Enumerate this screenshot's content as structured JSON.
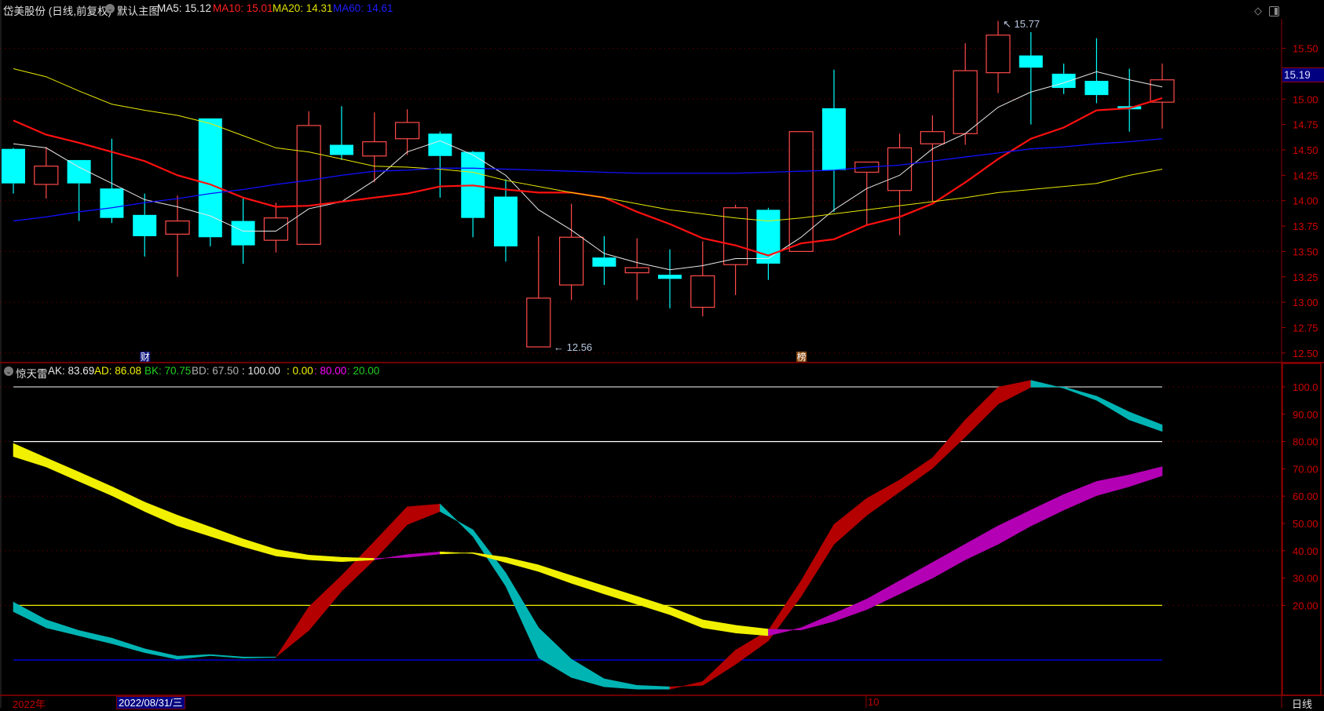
{
  "header": {
    "title": "岱美股份 (日线,前复权)",
    "template": "默认主图",
    "ma": [
      {
        "label": "MA5: 15.12",
        "color": "#e8e8e8"
      },
      {
        "label": "MA10: 15.01",
        "color": "#ff2020"
      },
      {
        "label": "MA20: 14.31",
        "color": "#e0e000"
      },
      {
        "label": "MA60: 14.61",
        "color": "#1e1eff"
      }
    ]
  },
  "indicator_header": {
    "name": "惊天雷",
    "values": [
      {
        "text": "AK: 83.69",
        "color": "#e8e8e8"
      },
      {
        "text": "AD: 86.08",
        "color": "#f0f000"
      },
      {
        "text": "BK: 70.75",
        "color": "#20d020"
      },
      {
        "text": "BD: 67.50",
        "color": "#b0b0b0"
      },
      {
        "text": ": 100.00",
        "color": "#e8e8e8"
      },
      {
        "text": ": 0.00",
        "color": "#f0f000"
      },
      {
        "text": ": 80.00",
        "color": "#ff00ff"
      },
      {
        "text": ": 20.00",
        "color": "#20d020"
      }
    ]
  },
  "markers": [
    {
      "label": "财",
      "index": 4,
      "color": "#101880"
    },
    {
      "label": "榜",
      "index": 24,
      "color": "#8a4a10"
    }
  ],
  "last_price": "15.19",
  "bottom_axis": {
    "year": "2022年",
    "cursor_date": "2022/08/31/三",
    "month": "10",
    "period": "日线"
  },
  "colors": {
    "up": "#ff4a4a",
    "down": "#00ffff",
    "grid": "#800000",
    "axis": "#a00000"
  },
  "chart_data": [
    {
      "type": "candlestick",
      "title": "岱美股份 (日线,前复权)",
      "ylim": [
        12.5,
        15.5
      ],
      "y_ticks": [
        "15.50",
        "15.25",
        "15.00",
        "14.75",
        "14.50",
        "14.25",
        "14.00",
        "13.75",
        "13.50",
        "13.25",
        "13.00",
        "12.75",
        "12.50"
      ],
      "y_tick_values": [
        15.5,
        15.25,
        15.0,
        14.75,
        14.5,
        14.25,
        14.0,
        13.75,
        13.5,
        13.25,
        13.0,
        12.75,
        12.5
      ],
      "annotations": {
        "high": "15.77",
        "high_index": 30,
        "low": "12.56",
        "low_index": 16
      },
      "ohlc": [
        [
          14.51,
          14.52,
          14.07,
          14.17
        ],
        [
          14.16,
          14.53,
          14.02,
          14.34
        ],
        [
          14.4,
          14.4,
          13.8,
          14.17
        ],
        [
          14.12,
          14.61,
          13.78,
          13.83
        ],
        [
          13.86,
          14.07,
          13.45,
          13.65
        ],
        [
          13.67,
          14.05,
          13.25,
          13.8
        ],
        [
          14.81,
          14.81,
          13.55,
          13.64
        ],
        [
          13.8,
          14.03,
          13.38,
          13.56
        ],
        [
          13.61,
          13.98,
          13.49,
          13.83
        ],
        [
          13.57,
          14.88,
          13.57,
          14.74
        ],
        [
          14.55,
          14.93,
          14.4,
          14.45
        ],
        [
          14.44,
          14.87,
          14.18,
          14.58
        ],
        [
          14.61,
          14.9,
          14.45,
          14.77
        ],
        [
          14.66,
          14.68,
          14.03,
          14.44
        ],
        [
          14.48,
          14.49,
          13.64,
          13.83
        ],
        [
          14.04,
          14.21,
          13.4,
          13.55
        ],
        [
          12.56,
          13.65,
          12.56,
          13.04
        ],
        [
          13.17,
          13.97,
          13.02,
          13.64
        ],
        [
          13.44,
          13.65,
          13.17,
          13.35
        ],
        [
          13.29,
          13.63,
          13.02,
          13.34
        ],
        [
          13.27,
          13.52,
          12.94,
          13.23
        ],
        [
          12.95,
          13.6,
          12.86,
          13.26
        ],
        [
          13.37,
          13.96,
          13.07,
          13.93
        ],
        [
          13.91,
          13.93,
          13.22,
          13.38
        ],
        [
          13.5,
          14.68,
          13.5,
          14.68
        ],
        [
          14.91,
          15.29,
          13.89,
          14.3
        ],
        [
          14.28,
          14.38,
          13.76,
          14.38
        ],
        [
          14.1,
          14.66,
          13.66,
          14.52
        ],
        [
          14.56,
          14.84,
          13.99,
          14.68
        ],
        [
          14.66,
          15.55,
          14.55,
          15.28
        ],
        [
          15.26,
          15.77,
          15.06,
          15.63
        ],
        [
          15.43,
          15.66,
          14.75,
          15.31
        ],
        [
          15.25,
          15.35,
          15.05,
          15.11
        ],
        [
          15.18,
          15.6,
          14.96,
          15.04
        ],
        [
          14.93,
          15.3,
          14.68,
          14.9
        ],
        [
          14.97,
          15.35,
          14.71,
          15.19
        ]
      ],
      "series": [
        {
          "name": "MA5",
          "color": "#e8e8e8",
          "width": 1,
          "values": [
            14.56,
            14.52,
            14.33,
            14.17,
            14.01,
            13.94,
            13.85,
            13.7,
            13.7,
            13.92,
            13.99,
            14.2,
            14.48,
            14.59,
            14.45,
            14.25,
            13.91,
            13.71,
            13.48,
            13.39,
            13.32,
            13.36,
            13.43,
            13.43,
            13.64,
            13.91,
            14.12,
            14.25,
            14.51,
            14.66,
            14.92,
            15.07,
            15.16,
            15.27,
            15.19,
            15.12
          ]
        },
        {
          "name": "MA10",
          "color": "#ff1010",
          "width": 2.2,
          "values": [
            14.79,
            14.65,
            14.57,
            14.48,
            14.39,
            14.25,
            14.16,
            14.03,
            13.94,
            13.95,
            13.99,
            14.03,
            14.07,
            14.14,
            14.15,
            14.11,
            14.08,
            14.08,
            14.03,
            13.89,
            13.77,
            13.63,
            13.56,
            13.46,
            13.58,
            13.62,
            13.76,
            13.84,
            13.97,
            14.18,
            14.41,
            14.61,
            14.72,
            14.89,
            14.91,
            15.01
          ]
        },
        {
          "name": "MA20",
          "color": "#e8e800",
          "width": 1,
          "values": [
            15.3,
            15.22,
            15.08,
            14.95,
            14.89,
            14.84,
            14.76,
            14.64,
            14.52,
            14.48,
            14.41,
            14.34,
            14.33,
            14.31,
            14.28,
            14.2,
            14.14,
            14.08,
            14.03,
            13.97,
            13.91,
            13.87,
            13.83,
            13.8,
            13.83,
            13.87,
            13.91,
            13.95,
            13.99,
            14.03,
            14.08,
            14.11,
            14.14,
            14.17,
            14.25,
            14.31
          ]
        },
        {
          "name": "MA60",
          "color": "#1010ff",
          "width": 1.3,
          "values": [
            13.8,
            13.84,
            13.89,
            13.93,
            13.98,
            14.02,
            14.07,
            14.11,
            14.16,
            14.2,
            14.25,
            14.29,
            14.3,
            14.32,
            14.32,
            14.31,
            14.3,
            14.29,
            14.28,
            14.27,
            14.27,
            14.27,
            14.27,
            14.28,
            14.29,
            14.3,
            14.33,
            14.35,
            14.39,
            14.43,
            14.47,
            14.51,
            14.53,
            14.56,
            14.58,
            14.61
          ]
        }
      ]
    },
    {
      "type": "area",
      "title": "惊天雷",
      "ylim": [
        -12,
        106
      ],
      "y_ticks": [
        "100.0",
        "90.00",
        "80.00",
        "70.00",
        "60.00",
        "50.00",
        "40.00",
        "30.00",
        "20.00"
      ],
      "y_tick_values": [
        100,
        90,
        80,
        70,
        60,
        50,
        40,
        30,
        20
      ],
      "reference_lines": [
        {
          "value": 100,
          "color": "#c8c8c8"
        },
        {
          "value": 80,
          "color": "#ffffff"
        },
        {
          "value": 20,
          "color": "#f0f000"
        },
        {
          "value": 0,
          "color": "#0000ff"
        }
      ],
      "bands": [
        {
          "name": "AK/AD",
          "up_color": "#b40000",
          "down_color": "#00b4b4",
          "AK": [
            17.7,
            11.8,
            8.9,
            6.0,
            2.7,
            0.3,
            1.6,
            0.7,
            1.0,
            19.4,
            30.9,
            43.4,
            56.1,
            57.1,
            45.3,
            27.1,
            0.8,
            -6.4,
            -9.8,
            -10.7,
            -10.7,
            -7.9,
            3.6,
            10.8,
            29.0,
            49.6,
            59.2,
            65.9,
            74.0,
            87.9,
            99.9,
            102.4,
            99.5,
            95.1,
            87.9,
            83.69
          ],
          "AD": [
            21.2,
            14.7,
            10.8,
            8.0,
            4.1,
            1.4,
            2.0,
            1.1,
            1.1,
            10.8,
            25.2,
            36.7,
            49.6,
            54.4,
            47.7,
            31.9,
            11.8,
            0.3,
            -6.9,
            -9.3,
            -9.8,
            -9.3,
            -1.6,
            7.0,
            23.3,
            42.4,
            53.0,
            61.6,
            70.2,
            81.7,
            93.7,
            99.9,
            100.0,
            96.6,
            90.8,
            86.08
          ]
        },
        {
          "name": "BK/BD",
          "up_color": "#b400b4",
          "down_color": "#f0f000",
          "AK": [
            74.5,
            70.7,
            65.4,
            60.2,
            54.4,
            49.1,
            45.3,
            41.5,
            38.1,
            36.7,
            36.0,
            36.7,
            38.6,
            39.6,
            39.0,
            35.7,
            32.4,
            28.1,
            24.2,
            20.4,
            16.6,
            11.8,
            9.9,
            8.9,
            11.8,
            17.0,
            22.3,
            29.0,
            35.7,
            42.4,
            49.1,
            54.9,
            60.6,
            65.4,
            67.8,
            70.75
          ],
          "AD": [
            79.3,
            74.0,
            68.8,
            63.5,
            57.8,
            53.0,
            48.7,
            44.3,
            40.5,
            38.4,
            37.6,
            37.2,
            37.6,
            38.8,
            39.3,
            37.6,
            34.8,
            30.9,
            27.1,
            23.3,
            19.4,
            14.7,
            12.7,
            11.3,
            11.0,
            14.2,
            18.5,
            24.2,
            30.0,
            36.7,
            42.4,
            49.1,
            54.9,
            60.2,
            63.5,
            67.5
          ]
        }
      ]
    }
  ]
}
